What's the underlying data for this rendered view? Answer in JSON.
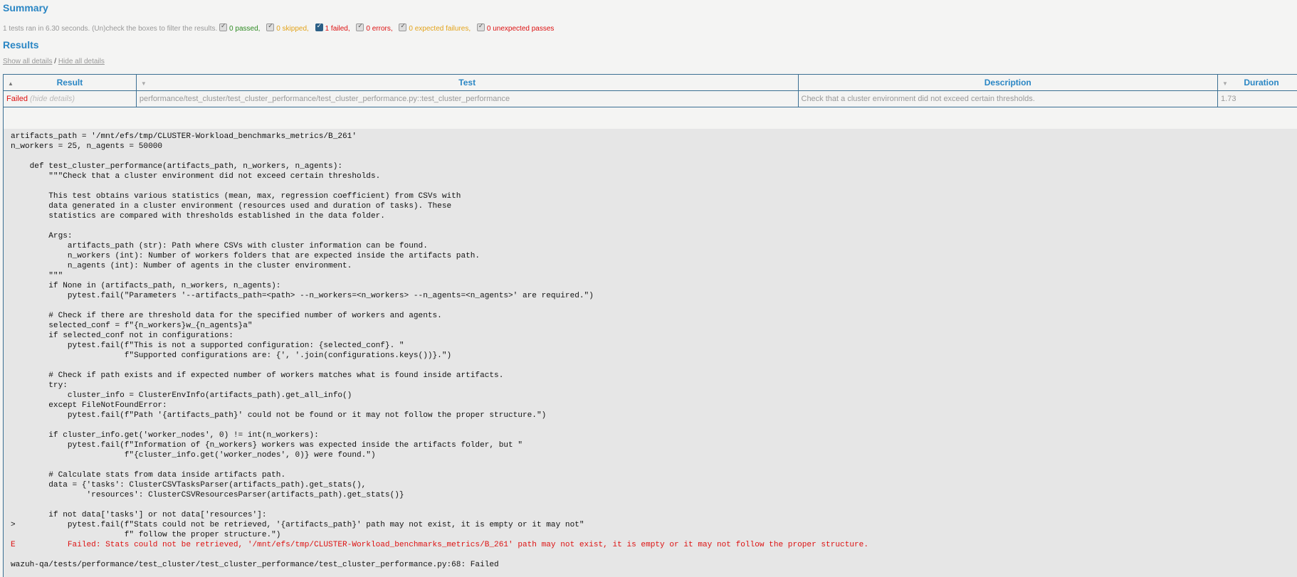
{
  "summary": {
    "heading": "Summary",
    "run_text": "1 tests ran in 6.30 seconds. (Un)check the boxes to filter the results.",
    "passed": "0 passed,",
    "skipped": "0 skipped,",
    "failed": "1 failed,",
    "errors": "0 errors,",
    "xfail": "0 expected failures,",
    "xpass": "0 unexpected passes"
  },
  "results": {
    "heading": "Results",
    "show_all": "Show all details",
    "separator": "/",
    "hide_all": "Hide all details",
    "columns": {
      "result": "Result",
      "test": "Test",
      "description": "Description",
      "duration": "Duration"
    },
    "row": {
      "result": "Failed",
      "hide_details": "(hide details)",
      "test": "performance/test_cluster/test_cluster_performance/test_cluster_performance.py::test_cluster_performance",
      "description": "Check that a cluster environment did not exceed certain thresholds.",
      "duration": "1.73"
    }
  },
  "log": {
    "lines": [
      "artifacts_path = '/mnt/efs/tmp/CLUSTER-Workload_benchmarks_metrics/B_261'",
      "n_workers = 25, n_agents = 50000",
      "",
      "    def test_cluster_performance(artifacts_path, n_workers, n_agents):",
      "        \"\"\"Check that a cluster environment did not exceed certain thresholds.",
      "",
      "        This test obtains various statistics (mean, max, regression coefficient) from CSVs with",
      "        data generated in a cluster environment (resources used and duration of tasks). These",
      "        statistics are compared with thresholds established in the data folder.",
      "",
      "        Args:",
      "            artifacts_path (str): Path where CSVs with cluster information can be found.",
      "            n_workers (int): Number of workers folders that are expected inside the artifacts path.",
      "            n_agents (int): Number of agents in the cluster environment.",
      "        \"\"\"",
      "        if None in (artifacts_path, n_workers, n_agents):",
      "            pytest.fail(\"Parameters '--artifacts_path=<path> --n_workers=<n_workers> --n_agents=<n_agents>' are required.\")",
      "",
      "        # Check if there are threshold data for the specified number of workers and agents.",
      "        selected_conf = f\"{n_workers}w_{n_agents}a\"",
      "        if selected_conf not in configurations:",
      "            pytest.fail(f\"This is not a supported configuration: {selected_conf}. \"",
      "                        f\"Supported configurations are: {', '.join(configurations.keys())}.\")",
      "",
      "        # Check if path exists and if expected number of workers matches what is found inside artifacts.",
      "        try:",
      "            cluster_info = ClusterEnvInfo(artifacts_path).get_all_info()",
      "        except FileNotFoundError:",
      "            pytest.fail(f\"Path '{artifacts_path}' could not be found or it may not follow the proper structure.\")",
      "",
      "        if cluster_info.get('worker_nodes', 0) != int(n_workers):",
      "            pytest.fail(f\"Information of {n_workers} workers was expected inside the artifacts folder, but \"",
      "                        f\"{cluster_info.get('worker_nodes', 0)} were found.\")",
      "",
      "        # Calculate stats from data inside artifacts path.",
      "        data = {'tasks': ClusterCSVTasksParser(artifacts_path).get_stats(),",
      "                'resources': ClusterCSVResourcesParser(artifacts_path).get_stats()}",
      "",
      "        if not data['tasks'] or not data['resources']:",
      ">           pytest.fail(f\"Stats could not be retrieved, '{artifacts_path}' path may not exist, it is empty or it may not\"",
      "                        f\" follow the proper structure.\")",
      "E           Failed: Stats could not be retrieved, '/mnt/efs/tmp/CLUSTER-Workload_benchmarks_metrics/B_261' path may not exist, it is empty or it may not follow the proper structure.",
      "",
      "wazuh-qa/tests/performance/test_cluster/test_cluster_performance/test_cluster_performance.py:68: Failed"
    ],
    "error_line_index": 41
  }
}
